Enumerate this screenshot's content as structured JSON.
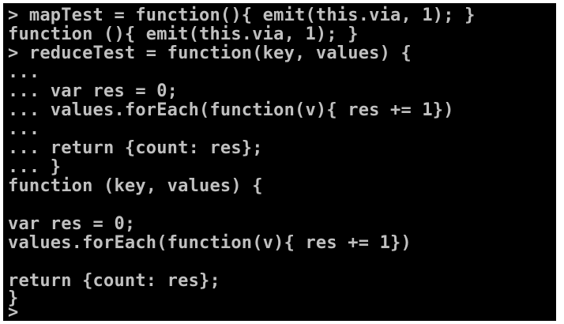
{
  "console": {
    "lines": [
      "> mapTest = function(){ emit(this.via, 1); }",
      "function (){ emit(this.via, 1); }",
      "> reduceTest = function(key, values) {",
      "...",
      "... var res = 0;",
      "... values.forEach(function(v){ res += 1})",
      "...",
      "... return {count: res};",
      "... }",
      "function (key, values) {",
      "",
      "var res = 0;",
      "values.forEach(function(v){ res += 1})",
      "",
      "return {count: res};",
      "}",
      ">"
    ],
    "colors": {
      "background": "#000000",
      "text": "#c0c0c0",
      "frame": "#ffffff"
    }
  }
}
